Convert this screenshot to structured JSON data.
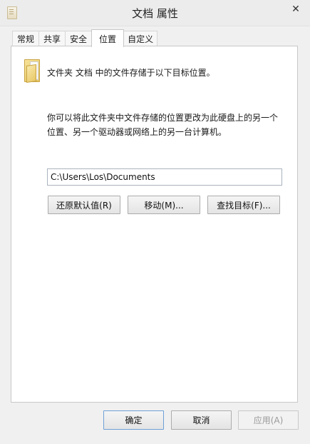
{
  "window": {
    "title": "文档 属性",
    "close_glyph": "✕"
  },
  "tabs": [
    {
      "label": "常规"
    },
    {
      "label": "共享"
    },
    {
      "label": "安全"
    },
    {
      "label": "位置",
      "active": true
    },
    {
      "label": "自定义"
    }
  ],
  "location": {
    "header": "文件夹 文档 中的文件存储于以下目标位置。",
    "description_line1": "你可以将此文件夹中文件存储的位置更改为此硬盘上的另一个",
    "description_line2": "位置、另一个驱动器或网络上的另一台计算机。",
    "path_value": "C:\\Users\\Los\\Documents",
    "restore_button": "还原默认值(R)",
    "move_button": "移动(M)...",
    "find_target_button": "查找目标(F)..."
  },
  "footer": {
    "ok_button": "确定",
    "cancel_button": "取消",
    "apply_button": "应用(A)"
  }
}
